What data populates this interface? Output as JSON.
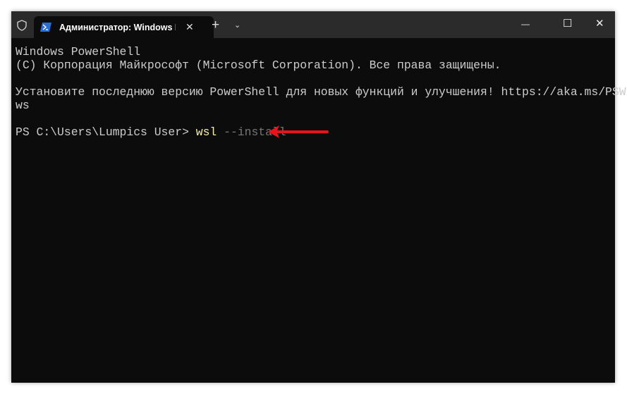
{
  "window": {
    "tab_title": "Администратор: Windows PowerShell",
    "new_tab": "+",
    "dropdown": "⌄",
    "minimize": "—",
    "maximize": "☐",
    "close": "✕",
    "tab_close": "✕"
  },
  "terminal": {
    "lines": [
      "Windows PowerShell",
      "(C) Корпорация Майкрософт (Microsoft Corporation). Все права защищены.",
      "",
      "Установите последнюю версию PowerShell для новых функций и улучшения! https://aka.ms/PSWindo",
      "ws",
      ""
    ],
    "prompt": "PS C:\\Users\\Lumpics User> ",
    "command": "wsl",
    "args": " --install"
  },
  "colors": {
    "arrow": "#e8141b",
    "background": "#0c0c0c",
    "titlebar": "#2b2b2b"
  }
}
